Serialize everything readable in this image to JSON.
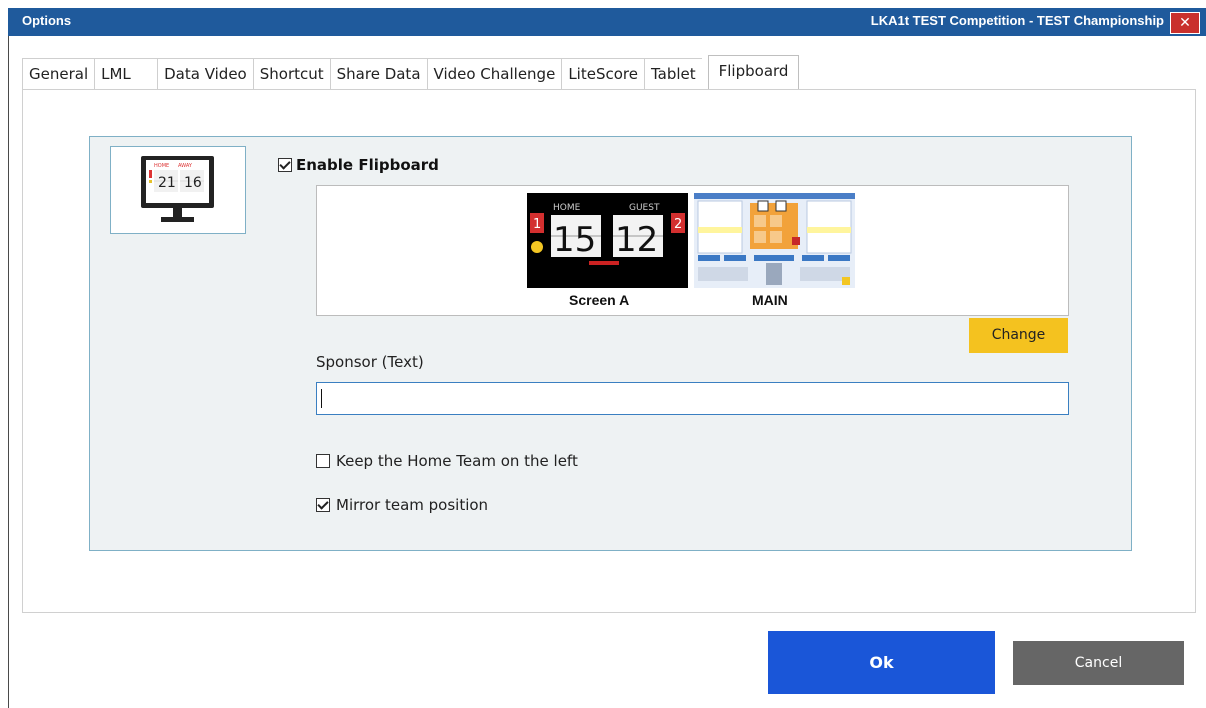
{
  "window": {
    "title": "Options",
    "subtitle": "LKA1t  TEST Competition - TEST Championship",
    "close_label": "✕",
    "accent": "#1f5a9c"
  },
  "tabs": [
    {
      "label": "General"
    },
    {
      "label": "LML"
    },
    {
      "label": "Data Video"
    },
    {
      "label": "Shortcut"
    },
    {
      "label": "Share Data"
    },
    {
      "label": "Video Challenge"
    },
    {
      "label": "LiteScore"
    },
    {
      "label": "Tablet"
    },
    {
      "label": "Flipboard",
      "active": true
    }
  ],
  "flipboard": {
    "icon": {
      "home": "HOME",
      "away": "AWAY",
      "home_score": "21",
      "away_score": "16",
      "name": "monitor-scoreboard-icon"
    },
    "enable_label": "Enable Flipboard",
    "enable_checked": true,
    "preview": {
      "screen_a": {
        "caption": "Screen A",
        "home": "HOME",
        "guest": "GUEST",
        "home_score": "15",
        "guest_score": "12",
        "home_sets": "1",
        "guest_sets": "2"
      },
      "main": {
        "caption": "MAIN"
      }
    },
    "change_label": "Change",
    "sponsor_label": "Sponsor (Text)",
    "sponsor_value": "",
    "keep_home_left_label": "Keep the Home Team on the left",
    "keep_home_left_checked": false,
    "mirror_label": "Mirror team position",
    "mirror_checked": true
  },
  "buttons": {
    "ok_label": "Ok",
    "cancel_label": "Cancel",
    "ok_color": "#1a56d8",
    "cancel_color": "#666666",
    "change_color": "#f4c21f"
  }
}
